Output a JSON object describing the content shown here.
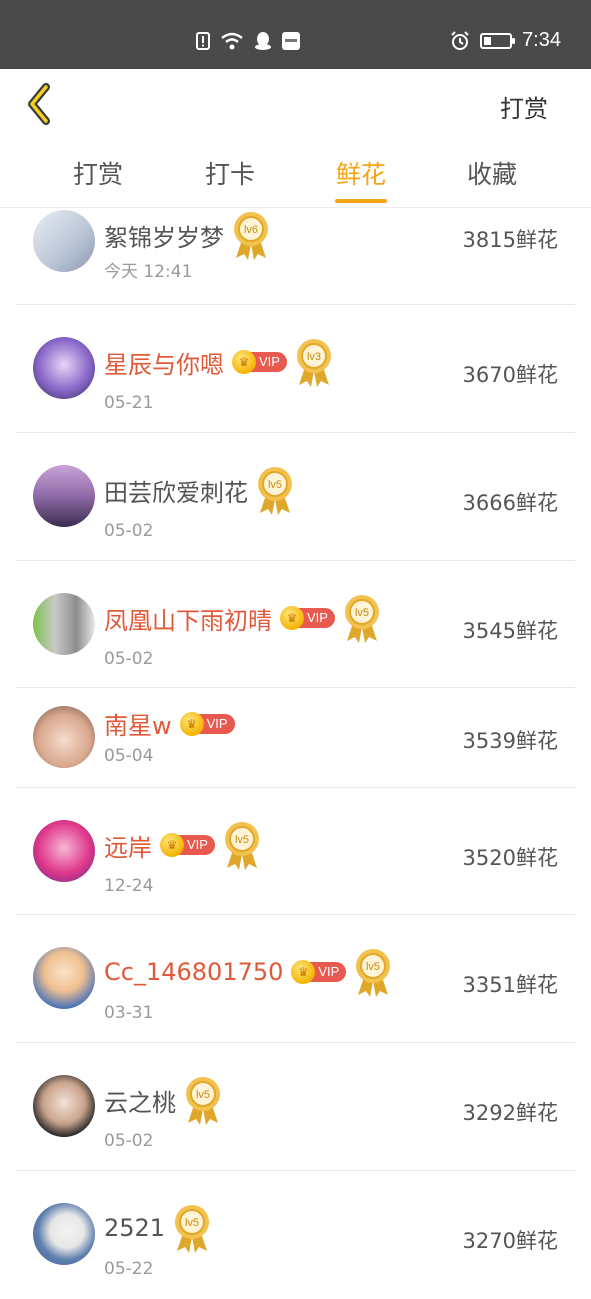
{
  "status_bar": {
    "time": "7:34"
  },
  "nav": {
    "back_icon": "chevron-left-icon",
    "right_label": "打赏"
  },
  "tabs": [
    {
      "label": "打赏"
    },
    {
      "label": "打卡"
    },
    {
      "label": "鲜花",
      "active": true
    },
    {
      "label": "收藏"
    }
  ],
  "vip_label": "VIP",
  "rows": [
    {
      "name": "絮锦岁岁梦",
      "vip": false,
      "level": "lv6",
      "date": "今天 12:41",
      "count": "3815鲜花"
    },
    {
      "name": "星辰与你嗯",
      "vip": true,
      "level": "lv3",
      "date": "05-21",
      "count": "3670鲜花"
    },
    {
      "name": "田芸欣爱刺花",
      "vip": false,
      "level": "lv5",
      "date": "05-02",
      "count": "3666鲜花"
    },
    {
      "name": "凤凰山下雨初晴",
      "vip": true,
      "level": "lv5",
      "date": "05-02",
      "count": "3545鲜花"
    },
    {
      "name": "南星w",
      "vip": true,
      "level": "",
      "date": "05-04",
      "count": "3539鲜花"
    },
    {
      "name": "远岸",
      "vip": true,
      "level": "lv5",
      "date": "12-24",
      "count": "3520鲜花"
    },
    {
      "name": "Cc_146801750",
      "vip": true,
      "level": "lv5",
      "date": "03-31",
      "count": "3351鲜花"
    },
    {
      "name": "云之桃",
      "vip": false,
      "level": "lv5",
      "date": "05-02",
      "count": "3292鲜花"
    },
    {
      "name": "2521",
      "vip": false,
      "level": "lv5",
      "date": "05-22",
      "count": "3270鲜花"
    }
  ],
  "colors": {
    "accent": "#f5a416",
    "vip_name": "#e05a3a",
    "vip_tag": "#e85a4f"
  }
}
